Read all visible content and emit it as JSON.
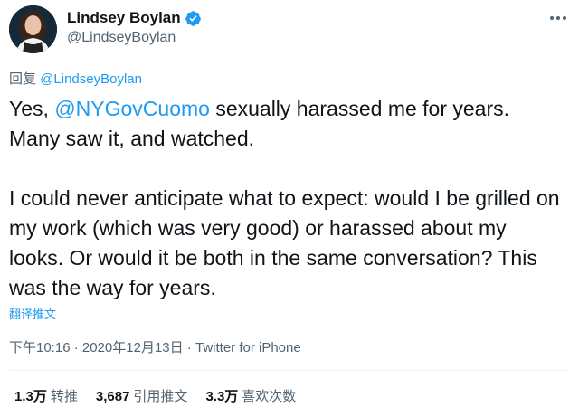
{
  "user": {
    "display_name": "Lindsey Boylan",
    "handle": "@LindseyBoylan",
    "verified": true,
    "avatar_icon": "profile-photo"
  },
  "reply_to": {
    "prefix": "回复",
    "handle": "@LindseyBoylan"
  },
  "tweet": {
    "p1_before": "Yes, ",
    "p1_mention": "@NYGovCuomo",
    "p1_after": " sexually harassed me for years. Many saw it, and watched.",
    "p2": "I could never anticipate what to expect: would I be grilled on my work (which was very good) or harassed about my looks. Or would it be both in the same conversation? This was the way for years."
  },
  "translate_label": "翻译推文",
  "meta": {
    "time": "下午10:16",
    "separator": " · ",
    "date": "2020年12月13日",
    "app": "Twitter for iPhone"
  },
  "stats": {
    "retweets_count": "1.3万",
    "retweets_label": "转推",
    "quotes_count": "3,687",
    "quotes_label": "引用推文",
    "likes_count": "3.3万",
    "likes_label": "喜欢次数"
  },
  "colors": {
    "accent": "#1d9bf0",
    "text": "#0f1419",
    "secondary": "#536471"
  }
}
